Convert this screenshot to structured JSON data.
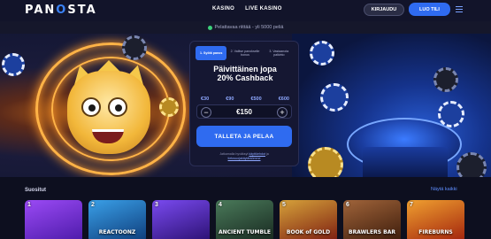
{
  "header": {
    "logo": "PANOSTA",
    "nav": [
      "KASINO",
      "LIVE KASINO"
    ],
    "login_label": "KIRJAUDU",
    "join_label": "LUO TILI",
    "menu_icon": "hamburger-menu-icon"
  },
  "notice": {
    "text": "Pelattavaa riittää - yli 5000 peliä"
  },
  "promo": {
    "steps": [
      "1. Syötä panos",
      "2. Valitse panokselle bonus",
      "3. Vastaanota palkinto"
    ],
    "title_line1": "Päivittäinen jopa",
    "title_line2": "20% Cashback",
    "amounts": [
      "€30",
      "€90",
      "€500",
      "€600"
    ],
    "amount_value": "€150",
    "minus": "−",
    "plus": "+",
    "cta_label": "TALLETA JA PELAA",
    "terms_line1": "Jatkamalla hyväksyt ",
    "terms_link1": "käyttöehdot",
    "terms_mid": " ja",
    "terms_link2": "tietosuojakäytäntömme"
  },
  "popular": {
    "title": "Suositut",
    "show_all": "Näytä kaikki",
    "games": [
      {
        "rank": "1",
        "name": "",
        "color": "#7b2ff0"
      },
      {
        "rank": "2",
        "name": "REACTOONZ",
        "color": "#1a6fb5"
      },
      {
        "rank": "3",
        "name": "",
        "color": "#5b2ab8"
      },
      {
        "rank": "4",
        "name": "ANCIENT TUMBLE",
        "color": "#2c4a3a"
      },
      {
        "rank": "5",
        "name": "BOOK of GOLD",
        "color": "#9c2a1a"
      },
      {
        "rank": "6",
        "name": "BRAWLERS BAR",
        "color": "#6a3a1a"
      },
      {
        "rank": "7",
        "name": "FIREBURNS",
        "color": "#b83a12"
      }
    ]
  },
  "colors": {
    "accent": "#2f6bf0",
    "background": "#0d0f1f"
  }
}
